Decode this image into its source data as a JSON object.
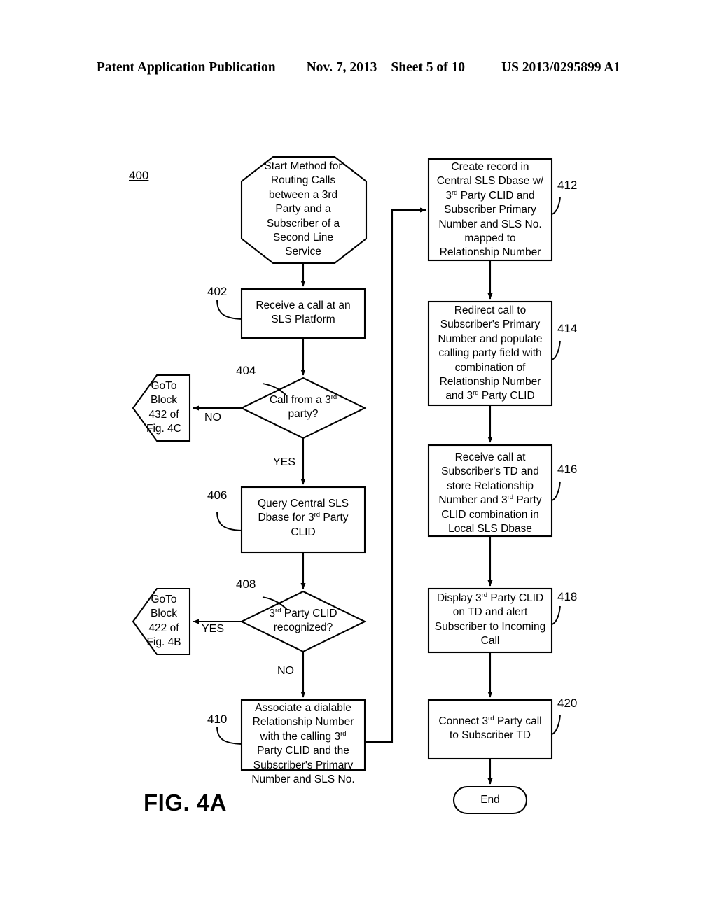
{
  "header": {
    "publication": "Patent Application Publication",
    "date": "Nov. 7, 2013",
    "sheet": "Sheet 5 of 10",
    "patent_number": "US 2013/0295899 A1"
  },
  "figure": {
    "label": "FIG. 4A",
    "diagram_number": "400",
    "type": "flowchart"
  },
  "nodes": {
    "start": {
      "shape": "hexagon",
      "text": "Start Method for\nRouting Calls\nbetween a 3rd\nParty and a\nSubscriber of a\nSecond Line\nService"
    },
    "n402": {
      "ref": "402",
      "shape": "process",
      "text": "Receive a call at an\nSLS Platform"
    },
    "n404": {
      "ref": "404",
      "shape": "decision",
      "text_html": "Call from a 3<sup>rd</sup>\nparty?"
    },
    "goto432": {
      "shape": "pentagon-left",
      "text": "GoTo\nBlock\n432 of\nFig. 4C"
    },
    "n406": {
      "ref": "406",
      "shape": "process",
      "text_html": "Query Central SLS\nDbase for 3<sup>rd</sup> Party\nCLID"
    },
    "n408": {
      "ref": "408",
      "shape": "decision",
      "text_html": "3<sup>rd</sup> Party CLID\nrecognized?"
    },
    "goto422": {
      "shape": "pentagon-left",
      "text": "GoTo\nBlock\n422 of\nFig. 4B"
    },
    "n410": {
      "ref": "410",
      "shape": "process",
      "text_html": "Associate a dialable\nRelationship Number\nwith the calling 3<sup>rd</sup>\nParty CLID and the\nSubscriber's Primary\nNumber and SLS No."
    },
    "n412": {
      "ref": "412",
      "shape": "process",
      "text_html": "Create record in\nCentral SLS Dbase w/\n3<sup>rd</sup> Party CLID and\nSubscriber Primary\nNumber and SLS No.\nmapped to\nRelationship Number"
    },
    "n414": {
      "ref": "414",
      "shape": "process",
      "text_html": "Redirect call to\nSubscriber's Primary\nNumber and populate\ncalling party field with\ncombination of\nRelationship Number\nand 3<sup>rd</sup> Party CLID"
    },
    "n416": {
      "ref": "416",
      "shape": "process",
      "text_html": "Receive call at\nSubscriber's TD and\nstore Relationship\nNumber and 3<sup>rd</sup> Party\nCLID combination in\nLocal SLS Dbase"
    },
    "n418": {
      "ref": "418",
      "shape": "process",
      "text_html": "Display 3<sup>rd</sup> Party CLID\non TD and alert\nSubscriber to Incoming\nCall"
    },
    "n420": {
      "ref": "420",
      "shape": "process",
      "text_html": "Connect 3<sup>rd</sup> Party call\nto Subscriber TD"
    },
    "end": {
      "shape": "terminator",
      "text": "End"
    }
  },
  "edge_labels": {
    "no_404": "NO",
    "yes_404": "YES",
    "yes_408": "YES",
    "no_408": "NO"
  },
  "colors": {
    "stroke": "#000000",
    "background": "#ffffff",
    "text": "#000000"
  }
}
